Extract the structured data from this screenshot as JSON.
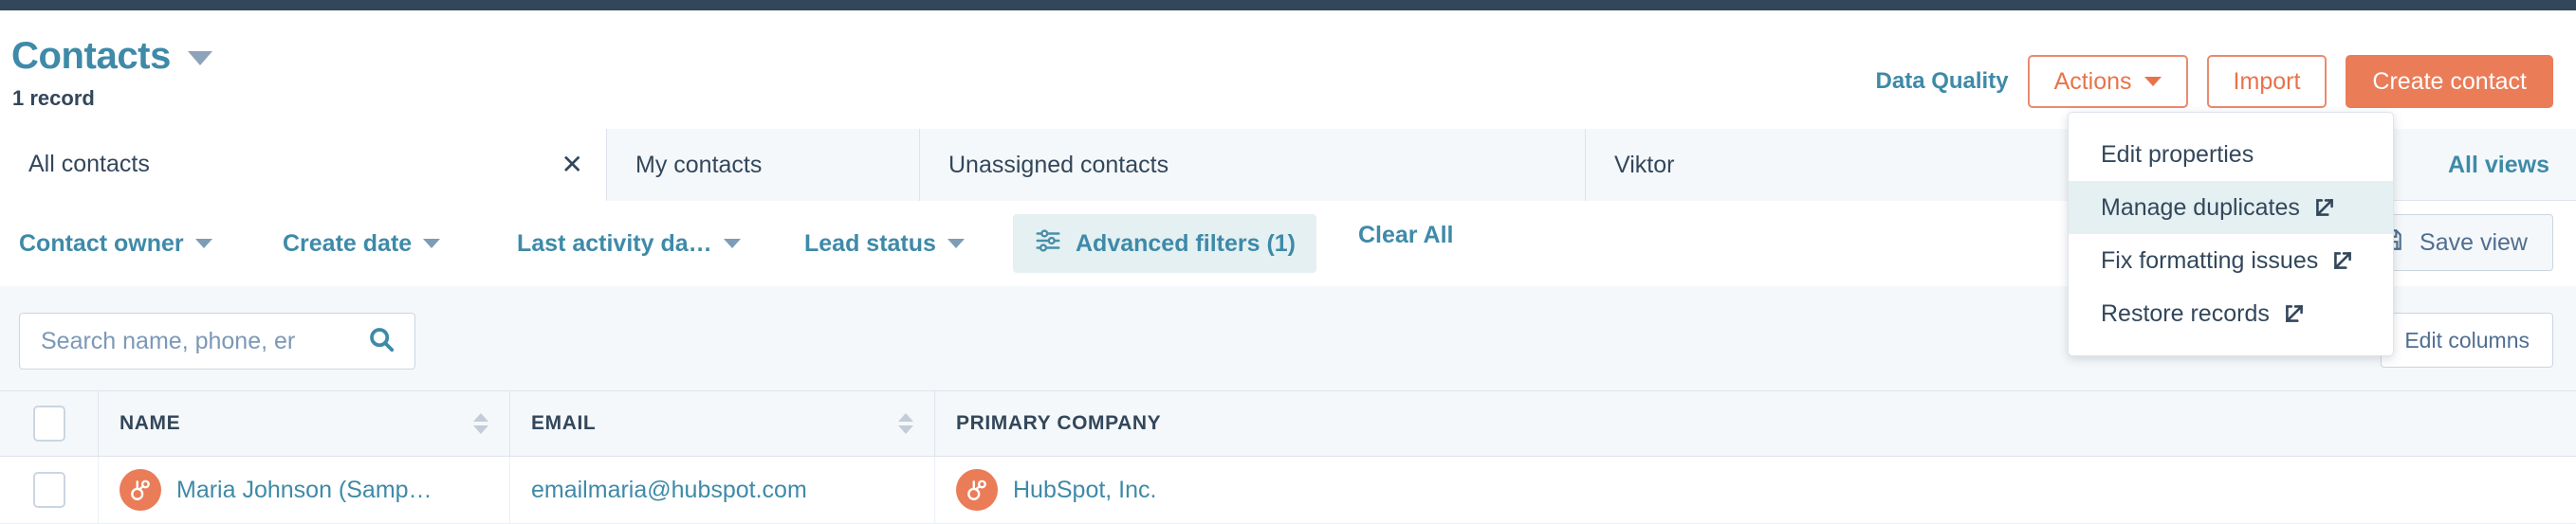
{
  "header": {
    "title": "Contacts",
    "record_count": "1 record",
    "data_quality_label": "Data Quality",
    "actions_label": "Actions",
    "import_label": "Import",
    "create_contact_label": "Create contact",
    "accent_teal": "#3e8aa8",
    "accent_orange": "#ea7c58",
    "topbar_color": "#33475b"
  },
  "actions_menu": {
    "items": [
      {
        "label": "Edit properties",
        "external": false,
        "highlighted": false
      },
      {
        "label": "Manage duplicates",
        "external": true,
        "highlighted": true
      },
      {
        "label": "Fix formatting issues",
        "external": true,
        "highlighted": false
      },
      {
        "label": "Restore records",
        "external": true,
        "highlighted": false
      }
    ]
  },
  "tabs": {
    "items": [
      {
        "label": "All contacts",
        "active": true,
        "closable": true
      },
      {
        "label": "My contacts",
        "active": false,
        "closable": false
      },
      {
        "label": "Unassigned contacts",
        "active": false,
        "closable": false
      },
      {
        "label": "Viktor",
        "active": false,
        "closable": false
      }
    ],
    "close_glyph": "✕",
    "all_views_label": "All views"
  },
  "filters": {
    "items": [
      {
        "label": "Contact owner"
      },
      {
        "label": "Create date"
      },
      {
        "label": "Last activity da…"
      },
      {
        "label": "Lead status"
      }
    ],
    "advanced_filters_label": "Advanced filters (1)",
    "clear_all_label": "Clear All",
    "save_view_label": "Save view"
  },
  "search": {
    "placeholder": "Search name, phone, er",
    "value": "",
    "edit_columns_label": "Edit columns"
  },
  "table": {
    "columns": [
      {
        "label": "NAME",
        "sortable": true
      },
      {
        "label": "EMAIL",
        "sortable": true
      },
      {
        "label": "PRIMARY COMPANY",
        "sortable": false
      }
    ],
    "rows": [
      {
        "name": "Maria Johnson (Samp…",
        "email": "emailmaria@hubspot.com",
        "company": "HubSpot, Inc."
      }
    ]
  }
}
